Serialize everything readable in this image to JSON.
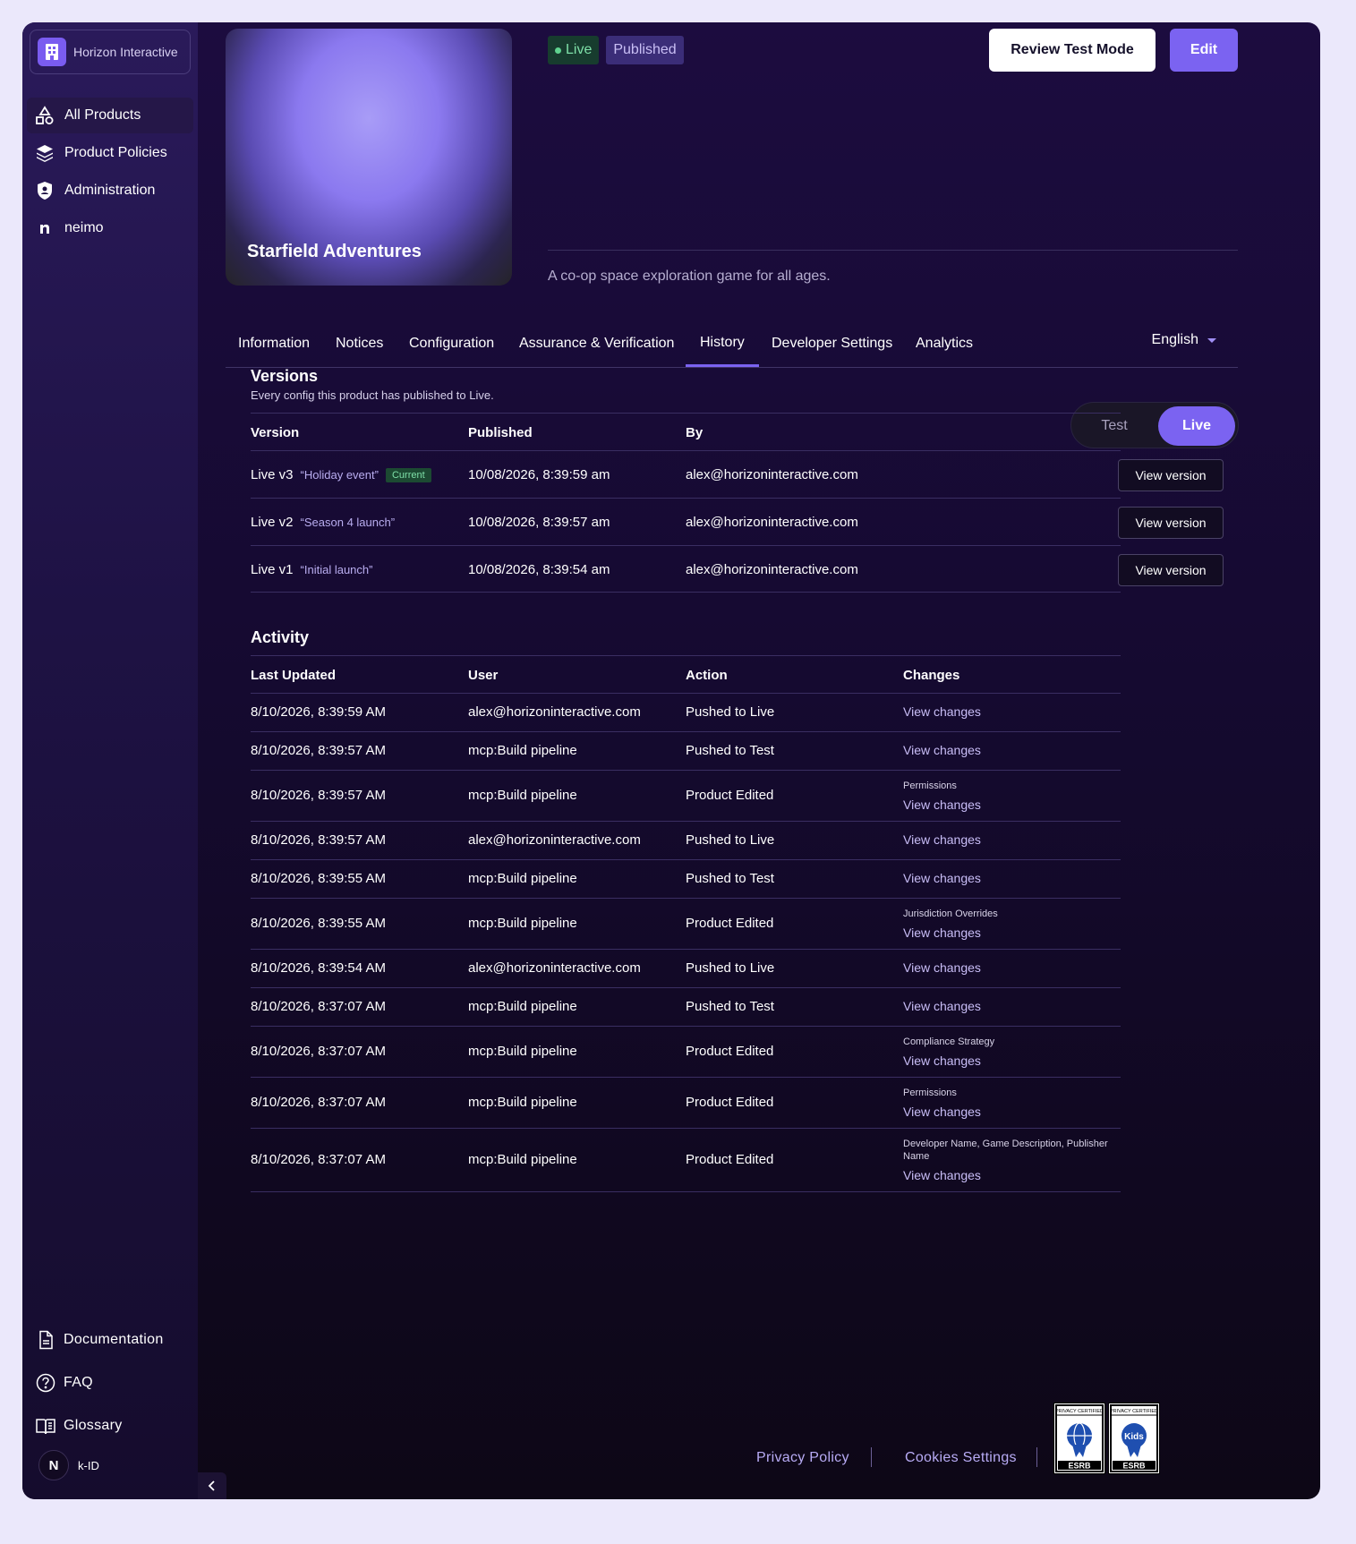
{
  "org": {
    "name": "Horizon Interactive"
  },
  "nav": [
    {
      "label": "All Products",
      "icon": "shapes-icon"
    },
    {
      "label": "Product Policies",
      "icon": "layers-icon"
    },
    {
      "label": "Administration",
      "icon": "shield-icon"
    },
    {
      "label": "neimo",
      "icon": "n-icon"
    }
  ],
  "bottom_nav": [
    {
      "label": "Documentation",
      "icon": "document-icon"
    },
    {
      "label": "FAQ",
      "icon": "question-icon"
    },
    {
      "label": "Glossary",
      "icon": "book-icon"
    }
  ],
  "kid": {
    "avatar": "N",
    "label": "k-ID"
  },
  "product": {
    "title": "Starfield Adventures",
    "status_live": "Live",
    "status_published": "Published",
    "description": "A co-op space exploration game for all ages.",
    "review_button": "Review Test Mode",
    "edit_button": "Edit"
  },
  "tabs": [
    "Information",
    "Notices",
    "Configuration",
    "Assurance & Verification",
    "History",
    "Developer Settings",
    "Analytics"
  ],
  "active_tab": "History",
  "language": "English",
  "versions": {
    "title": "Versions",
    "subtitle": "Every config this product has published to Live.",
    "toggle": {
      "test": "Test",
      "live": "Live",
      "selected": "Live"
    },
    "headers": {
      "version": "Version",
      "published": "Published",
      "by": "By"
    },
    "current_label": "Current",
    "view_label": "View version",
    "rows": [
      {
        "version": "Live v3",
        "tag": "“Holiday event”",
        "current": true,
        "published": "10/08/2026, 8:39:59 am",
        "by": "alex@horizoninteractive.com"
      },
      {
        "version": "Live v2",
        "tag": "“Season 4 launch”",
        "current": false,
        "published": "10/08/2026, 8:39:57 am",
        "by": "alex@horizoninteractive.com"
      },
      {
        "version": "Live v1",
        "tag": "“Initial launch”",
        "current": false,
        "published": "10/08/2026, 8:39:54 am",
        "by": "alex@horizoninteractive.com"
      }
    ]
  },
  "activity": {
    "title": "Activity",
    "headers": {
      "last_updated": "Last Updated",
      "user": "User",
      "action": "Action",
      "changes": "Changes"
    },
    "link_label": "View changes",
    "rows": [
      {
        "time": "8/10/2026, 8:39:59 AM",
        "user": "alex@horizoninteractive.com",
        "action": "Pushed to Live",
        "category": ""
      },
      {
        "time": "8/10/2026, 8:39:57 AM",
        "user": "mcp:Build pipeline",
        "action": "Pushed to Test",
        "category": ""
      },
      {
        "time": "8/10/2026, 8:39:57 AM",
        "user": "mcp:Build pipeline",
        "action": "Product Edited",
        "category": "Permissions"
      },
      {
        "time": "8/10/2026, 8:39:57 AM",
        "user": "alex@horizoninteractive.com",
        "action": "Pushed to Live",
        "category": ""
      },
      {
        "time": "8/10/2026, 8:39:55 AM",
        "user": "mcp:Build pipeline",
        "action": "Pushed to Test",
        "category": ""
      },
      {
        "time": "8/10/2026, 8:39:55 AM",
        "user": "mcp:Build pipeline",
        "action": "Product Edited",
        "category": "Jurisdiction Overrides"
      },
      {
        "time": "8/10/2026, 8:39:54 AM",
        "user": "alex@horizoninteractive.com",
        "action": "Pushed to Live",
        "category": ""
      },
      {
        "time": "8/10/2026, 8:37:07 AM",
        "user": "mcp:Build pipeline",
        "action": "Pushed to Test",
        "category": ""
      },
      {
        "time": "8/10/2026, 8:37:07 AM",
        "user": "mcp:Build pipeline",
        "action": "Product Edited",
        "category": "Compliance Strategy"
      },
      {
        "time": "8/10/2026, 8:37:07 AM",
        "user": "mcp:Build pipeline",
        "action": "Product Edited",
        "category": "Permissions"
      },
      {
        "time": "8/10/2026, 8:37:07 AM",
        "user": "mcp:Build pipeline",
        "action": "Product Edited",
        "category": "Developer Name, Game Description, Publisher Name"
      }
    ]
  },
  "footer": {
    "privacy": "Privacy Policy",
    "cookies": "Cookies Settings",
    "seal_top": "PRIVACY CERTIFIED",
    "seal_brand": "ESRB",
    "seal_kids": "Kids"
  }
}
